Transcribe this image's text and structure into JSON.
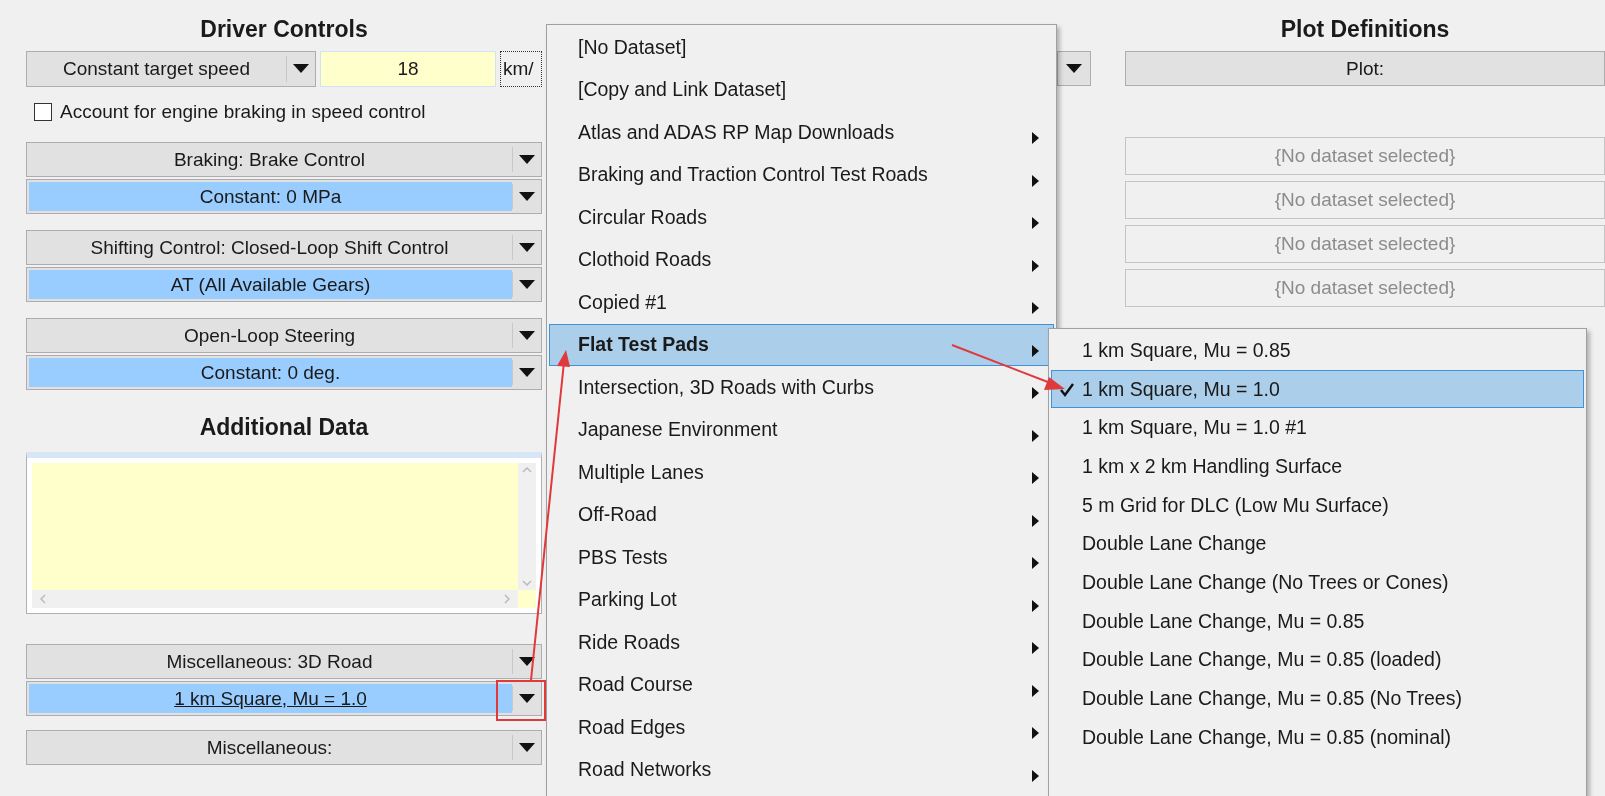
{
  "driver_controls": {
    "title": "Driver Controls",
    "speed_mode": "Constant target speed",
    "speed_value": "18",
    "speed_unit": "km/",
    "engine_braking": {
      "label": "Account for engine braking in speed control",
      "checked": false
    },
    "groups": [
      {
        "header": "Braking: Brake Control",
        "value": "Constant: 0 MPa",
        "linked": false
      },
      {
        "header": "Shifting Control: Closed-Loop Shift Control",
        "value": "AT (All Available Gears)",
        "linked": false
      },
      {
        "header": "Open-Loop Steering",
        "value": "Constant: 0 deg.",
        "linked": false
      }
    ]
  },
  "additional_data": {
    "title": "Additional Data",
    "groups": [
      {
        "header": "Miscellaneous: 3D Road",
        "value": "1 km Square, Mu = 1.0",
        "linked": true
      },
      {
        "header": "Miscellaneous:"
      }
    ]
  },
  "plot_definitions": {
    "title": "Plot Definitions",
    "plot": "Plot:",
    "datasets": [
      {
        "text": "{No dataset selected}",
        "disabled": true
      },
      {
        "text": "{No dataset selected}",
        "disabled": true
      },
      {
        "text": "{No dataset selected}",
        "disabled": true
      },
      {
        "text": "{No dataset selected}",
        "disabled": true
      }
    ]
  },
  "menu": {
    "items": [
      {
        "label": "[No Dataset]",
        "submenu": false,
        "selected": false
      },
      {
        "label": "[Copy and Link Dataset]",
        "submenu": false,
        "selected": false
      },
      {
        "label": "Atlas and ADAS RP Map Downloads",
        "submenu": true,
        "selected": false
      },
      {
        "label": "Braking and Traction Control Test Roads",
        "submenu": true,
        "selected": false
      },
      {
        "label": "Circular Roads",
        "submenu": true,
        "selected": false
      },
      {
        "label": "Clothoid Roads",
        "submenu": true,
        "selected": false
      },
      {
        "label": "Copied #1",
        "submenu": true,
        "selected": false
      },
      {
        "label": "Flat Test Pads",
        "submenu": true,
        "selected": true
      },
      {
        "label": "Intersection, 3D Roads with Curbs",
        "submenu": true,
        "selected": false
      },
      {
        "label": "Japanese Environment",
        "submenu": true,
        "selected": false
      },
      {
        "label": "Multiple Lanes",
        "submenu": true,
        "selected": false
      },
      {
        "label": "Off-Road",
        "submenu": true,
        "selected": false
      },
      {
        "label": "PBS Tests",
        "submenu": true,
        "selected": false
      },
      {
        "label": "Parking Lot",
        "submenu": true,
        "selected": false
      },
      {
        "label": "Ride Roads",
        "submenu": true,
        "selected": false
      },
      {
        "label": "Road Course",
        "submenu": true,
        "selected": false
      },
      {
        "label": "Road Edges",
        "submenu": true,
        "selected": false
      },
      {
        "label": "Road Networks",
        "submenu": true,
        "selected": false
      }
    ]
  },
  "submenu": {
    "items": [
      {
        "label": "1 km Square, Mu = 0.85",
        "checked": false,
        "selected": false
      },
      {
        "label": "1 km Square, Mu = 1.0",
        "checked": true,
        "selected": true
      },
      {
        "label": "1 km Square, Mu = 1.0 #1",
        "checked": false,
        "selected": false
      },
      {
        "label": "1 km x 2 km Handling Surface",
        "checked": false,
        "selected": false
      },
      {
        "label": "5 m Grid for DLC (Low Mu Surface)",
        "checked": false,
        "selected": false
      },
      {
        "label": "Double Lane Change",
        "checked": false,
        "selected": false
      },
      {
        "label": "Double Lane Change (No Trees or Cones)",
        "checked": false,
        "selected": false
      },
      {
        "label": "Double Lane Change, Mu = 0.85",
        "checked": false,
        "selected": false
      },
      {
        "label": "Double Lane Change, Mu = 0.85 (loaded)",
        "checked": false,
        "selected": false
      },
      {
        "label": "Double Lane Change, Mu = 0.85 (No Trees)",
        "checked": false,
        "selected": false
      },
      {
        "label": "Double Lane Change, Mu = 0.85 (nominal)",
        "checked": false,
        "selected": false
      }
    ]
  }
}
